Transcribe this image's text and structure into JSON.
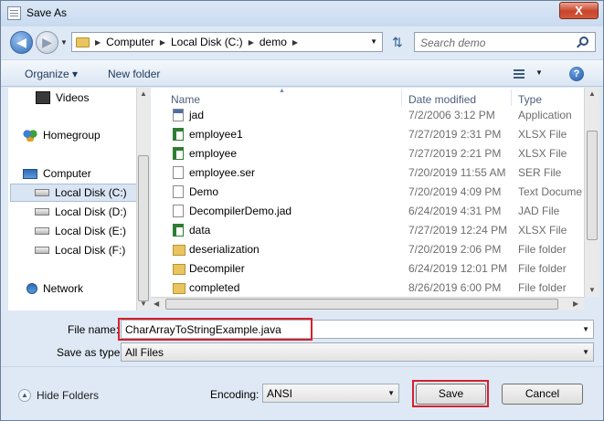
{
  "window": {
    "title": "Save As",
    "close": "X"
  },
  "nav": {
    "breadcrumb": [
      "Computer",
      "Local Disk (C:)",
      "demo"
    ],
    "search_placeholder": "Search demo"
  },
  "toolbar": {
    "organize": "Organize ▾",
    "new_folder": "New folder",
    "help": "?"
  },
  "sidebar": {
    "items": [
      {
        "label": "Videos",
        "icon": "video-icon"
      },
      {
        "label": "Homegroup",
        "icon": "homegroup-icon"
      },
      {
        "label": "Computer",
        "icon": "computer-icon"
      },
      {
        "label": "Local Disk (C:)",
        "icon": "disk-icon",
        "selected": true
      },
      {
        "label": "Local Disk (D:)",
        "icon": "disk-icon"
      },
      {
        "label": "Local Disk (E:)",
        "icon": "disk-icon"
      },
      {
        "label": "Local Disk (F:)",
        "icon": "disk-icon"
      },
      {
        "label": "Network",
        "icon": "network-icon"
      }
    ]
  },
  "files": {
    "columns": [
      "Name",
      "Date modified",
      "Type"
    ],
    "rows": [
      {
        "name": "jad",
        "date": "7/2/2006 3:12 PM",
        "type": "Application",
        "icon": "application-icon"
      },
      {
        "name": "employee1",
        "date": "7/27/2019 2:31 PM",
        "type": "XLSX File",
        "icon": "xlsx-icon"
      },
      {
        "name": "employee",
        "date": "7/27/2019 2:21 PM",
        "type": "XLSX File",
        "icon": "xlsx-icon"
      },
      {
        "name": "employee.ser",
        "date": "7/20/2019 11:55 AM",
        "type": "SER File",
        "icon": "document-icon"
      },
      {
        "name": "Demo",
        "date": "7/20/2019 4:09 PM",
        "type": "Text Docume",
        "icon": "document-icon"
      },
      {
        "name": "DecompilerDemo.jad",
        "date": "6/24/2019 4:31 PM",
        "type": "JAD File",
        "icon": "document-icon"
      },
      {
        "name": "data",
        "date": "7/27/2019 12:24 PM",
        "type": "XLSX File",
        "icon": "xlsx-icon"
      },
      {
        "name": "deserialization",
        "date": "7/20/2019 2:06 PM",
        "type": "File folder",
        "icon": "folder-icon"
      },
      {
        "name": "Decompiler",
        "date": "6/24/2019 12:01 PM",
        "type": "File folder",
        "icon": "folder-icon"
      },
      {
        "name": "completed",
        "date": "8/26/2019 6:00 PM",
        "type": "File folder",
        "icon": "folder-icon"
      }
    ]
  },
  "form": {
    "file_name_label": "File name:",
    "file_name_value": "CharArrayToStringExample.java",
    "save_type_label": "Save as type:",
    "save_type_value": "All Files",
    "encoding_label": "Encoding:",
    "encoding_value": "ANSI"
  },
  "footer": {
    "hide_folders": "Hide Folders",
    "save": "Save",
    "cancel": "Cancel"
  },
  "colors": {
    "highlight": "#d7202a",
    "window_bg": "#dfe9f5"
  }
}
